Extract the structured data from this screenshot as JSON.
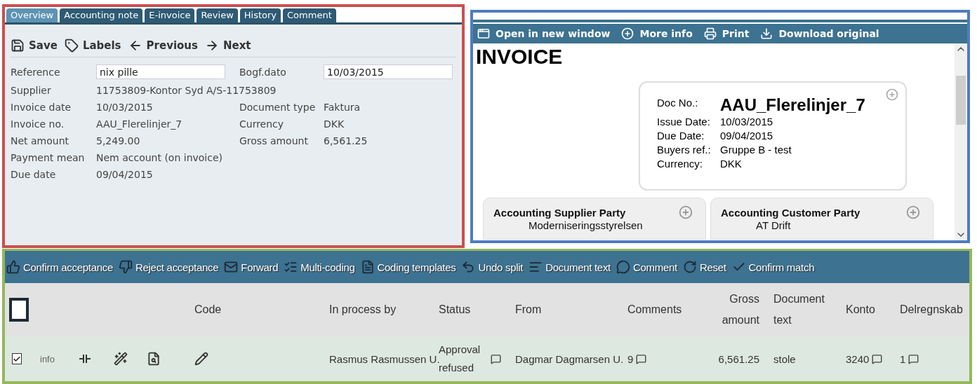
{
  "tabs": [
    {
      "label": "Overview",
      "selected": true
    },
    {
      "label": "Accounting note",
      "selected": false
    },
    {
      "label": "E-invoice",
      "selected": false
    },
    {
      "label": "Review",
      "selected": false
    },
    {
      "label": "History",
      "selected": false
    },
    {
      "label": "Comment",
      "selected": false
    }
  ],
  "record_toolbar": [
    {
      "label": "Save"
    },
    {
      "label": "Labels"
    },
    {
      "label": "Previous"
    },
    {
      "label": "Next"
    }
  ],
  "fields": [
    {
      "fields": [
        {
          "label": "Reference",
          "value": "nix pille",
          "kind": "input"
        },
        {
          "label": "Bogf.dato",
          "value": "10/03/2015",
          "kind": "input"
        }
      ]
    },
    {
      "fields": [
        {
          "label": "Supplier",
          "value": "11753809-Kontor Syd A/S-11753809",
          "kind": "text"
        }
      ]
    },
    {
      "fields": [
        {
          "label": "Invoice date",
          "value": "10/03/2015",
          "kind": "text"
        },
        {
          "label": "Document type",
          "value": "Faktura",
          "kind": "text"
        }
      ]
    },
    {
      "fields": [
        {
          "label": "Invoice no.",
          "value": "AAU_Flerelinjer_7",
          "kind": "text"
        },
        {
          "label": "Currency",
          "value": "DKK",
          "kind": "text"
        }
      ]
    },
    {
      "fields": [
        {
          "label": "Net amount",
          "value": "5,249.00",
          "kind": "text"
        },
        {
          "label": "Gross amount",
          "value": "6,561.25",
          "kind": "text"
        }
      ]
    },
    {
      "fields": [
        {
          "label": "Payment mean",
          "value": "Nem account (on invoice)",
          "kind": "text"
        }
      ]
    },
    {
      "fields": [
        {
          "label": "Due date",
          "value": "09/04/2015",
          "kind": "text"
        }
      ]
    }
  ],
  "viewer_toolbar": [
    {
      "label": "Open in new window"
    },
    {
      "label": "More info"
    },
    {
      "label": "Print"
    },
    {
      "label": "Download original"
    }
  ],
  "document": {
    "title": "INVOICE",
    "doc_no": {
      "label": "Doc No.:",
      "value": "AAU_Flerelinjer_7"
    },
    "details": [
      {
        "label": "Issue Date:",
        "value": "10/03/2015"
      },
      {
        "label": "Due Date:",
        "value": "09/04/2015"
      },
      {
        "label": "Buyers ref.:",
        "value": "Gruppe B - test"
      },
      {
        "label": "Currency:",
        "value": "DKK"
      }
    ],
    "parties": [
      {
        "title": "Accounting Supplier Party",
        "name": "Moderniseringsstyrelsen"
      },
      {
        "title": "Accounting Customer Party",
        "name": "AT Drift"
      }
    ]
  },
  "action_toolbar": [
    {
      "label": "Confirm acceptance"
    },
    {
      "label": "Reject acceptance"
    },
    {
      "label": "Forward"
    },
    {
      "label": "Multi-coding"
    },
    {
      "label": "Coding templates"
    },
    {
      "label": "Undo split"
    },
    {
      "label": "Document text"
    },
    {
      "label": "Comment"
    },
    {
      "label": "Reset"
    },
    {
      "label": "Confirm match"
    }
  ],
  "table": {
    "select_all": {
      "checked": false
    },
    "columns": [
      "Code",
      "In process by",
      "Status",
      "From",
      "Comments",
      "Gross amount",
      "Document text",
      "Konto",
      "Delregnskab"
    ],
    "rows": [
      {
        "checked": true,
        "info": "info",
        "in_process_by": "Rasmus Rasmussen U.",
        "status": "Approval refused",
        "from": "Dagmar Dagmarsen U.",
        "comments": "9",
        "gross_amount": "6,561.25",
        "document_text": "stole",
        "konto": "3240",
        "delregnskab": "1"
      }
    ]
  }
}
